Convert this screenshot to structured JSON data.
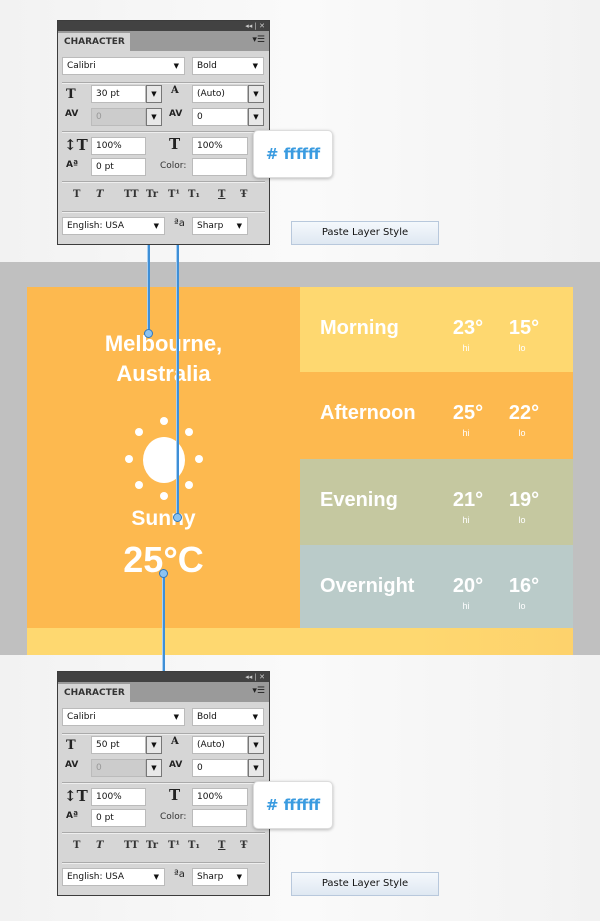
{
  "panels": [
    {
      "title": "CHARACTER",
      "font_family": "Calibri",
      "font_style": "Bold",
      "font_size": "30 pt",
      "leading": "(Auto)",
      "kerning": "0",
      "tracking": "0",
      "vertical_scale": "100%",
      "horizontal_scale": "100%",
      "baseline_shift": "0 pt",
      "color_label": "Color:",
      "language": "English: USA",
      "antialias": "Sharp",
      "color_tooltip": "# ffffff",
      "paste_button": "Paste Layer Style"
    },
    {
      "title": "CHARACTER",
      "font_family": "Calibri",
      "font_style": "Bold",
      "font_size": "50 pt",
      "leading": "(Auto)",
      "kerning": "0",
      "tracking": "0",
      "vertical_scale": "100%",
      "horizontal_scale": "100%",
      "baseline_shift": "0 pt",
      "color_label": "Color:",
      "language": "English: USA",
      "antialias": "Sharp",
      "color_tooltip": "# ffffff",
      "paste_button": "Paste Layer Style"
    }
  ],
  "style_buttons": [
    "T",
    "T",
    "TT",
    "Tr",
    "T¹",
    "T₁",
    "T",
    "Ŧ"
  ],
  "weather": {
    "city_line1": "Melbourne,",
    "city_line2": "Australia",
    "condition": "Sunny",
    "temperature": "25°C",
    "icon": "sun-icon",
    "rows": [
      {
        "name": "Morning",
        "hi": "23°",
        "lo": "15°",
        "hi_label": "hi",
        "lo_label": "lo",
        "color": "#fed870"
      },
      {
        "name": "Afternoon",
        "hi": "25°",
        "lo": "22°",
        "hi_label": "hi",
        "lo_label": "lo",
        "color": "#fdb94f"
      },
      {
        "name": "Evening",
        "hi": "21°",
        "lo": "19°",
        "hi_label": "hi",
        "lo_label": "lo",
        "color": "#c5c8a0"
      },
      {
        "name": "Overnight",
        "hi": "20°",
        "lo": "16°",
        "hi_label": "hi",
        "lo_label": "lo",
        "color": "#bacbc9"
      }
    ],
    "main_color": "#fdb94f"
  }
}
